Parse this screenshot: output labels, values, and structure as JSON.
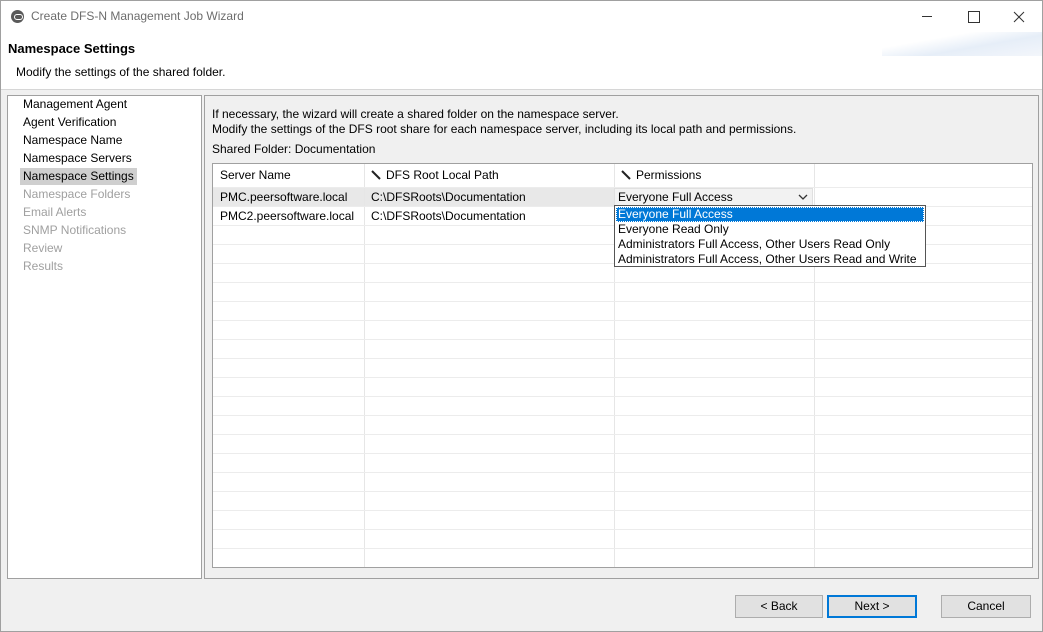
{
  "window": {
    "title": "Create DFS-N Management Job Wizard"
  },
  "header": {
    "title": "Namespace Settings",
    "subtitle": "Modify the settings of the shared folder."
  },
  "steps": [
    {
      "label": "Management Agent",
      "state": "done"
    },
    {
      "label": "Agent Verification",
      "state": "done"
    },
    {
      "label": "Namespace Name",
      "state": "done"
    },
    {
      "label": "Namespace Servers",
      "state": "done"
    },
    {
      "label": "Namespace Settings",
      "state": "current"
    },
    {
      "label": "Namespace Folders",
      "state": "disabled"
    },
    {
      "label": "Email Alerts",
      "state": "disabled"
    },
    {
      "label": "SNMP Notifications",
      "state": "disabled"
    },
    {
      "label": "Review",
      "state": "disabled"
    },
    {
      "label": "Results",
      "state": "disabled"
    }
  ],
  "content": {
    "info_line1": "If necessary, the wizard will create a shared folder on the namespace server.",
    "info_line2": "Modify the settings of the DFS root share for each namespace server, including its local path and permissions.",
    "shared_folder": "Shared Folder: Documentation"
  },
  "table": {
    "columns": [
      "Server Name",
      "DFS Root Local Path",
      "Permissions"
    ],
    "column_icons": [
      "",
      "pencil-icon",
      "pencil-icon"
    ],
    "rows": [
      {
        "server": "PMC.peersoftware.local",
        "path": "C:\\DFSRoots\\Documentation",
        "permissions": "Everyone Full Access"
      },
      {
        "server": "PMC2.peersoftware.local",
        "path": "C:\\DFSRoots\\Documentation",
        "permissions": ""
      }
    ]
  },
  "dropdown": {
    "selected": "Everyone Full Access",
    "options": [
      "Everyone Full Access",
      "Everyone Read Only",
      "Administrators Full Access, Other Users Read Only",
      "Administrators Full Access, Other Users Read and Write"
    ]
  },
  "buttons": {
    "back": "< Back",
    "next": "Next >",
    "cancel": "Cancel"
  },
  "colors": {
    "selection": "#0078d7",
    "disabled_text": "#a0a0a0",
    "step_highlight": "#cfcfcf"
  }
}
